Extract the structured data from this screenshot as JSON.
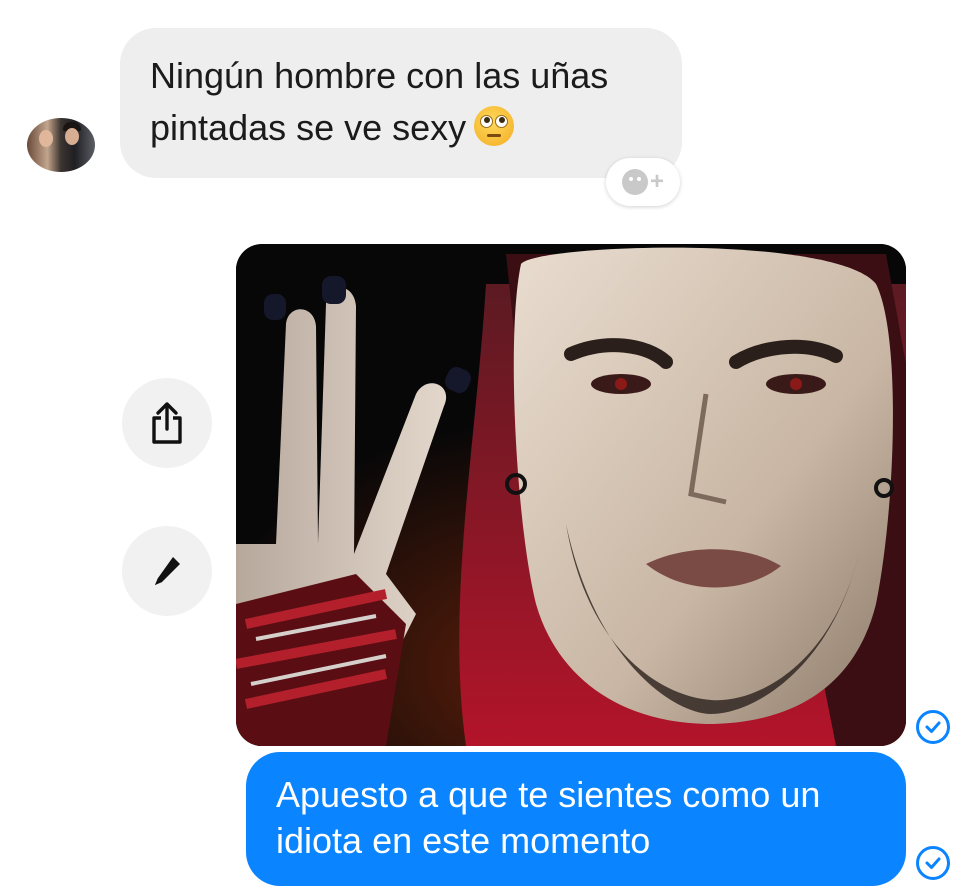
{
  "thread": {
    "incoming": {
      "text": "Ningún hombre con las uñas pintadas se ve sexy",
      "emoji": "face-with-rolling-eyes"
    },
    "reaction_button": {
      "icon": "add-reaction-icon"
    },
    "outgoing_image": {
      "description": "wrestler-holding-up-fingers-with-painted-nails"
    },
    "outgoing_text": "Apuesto a que te sientes como un idiota en este momento",
    "actions": [
      {
        "icon": "share-icon"
      },
      {
        "icon": "pencil-icon"
      }
    ],
    "status_icon": "delivered-check-icon"
  },
  "colors": {
    "outgoing_bubble": "#0a84ff",
    "incoming_bubble": "#eeeeee",
    "side_button": "#f1f1f1"
  }
}
